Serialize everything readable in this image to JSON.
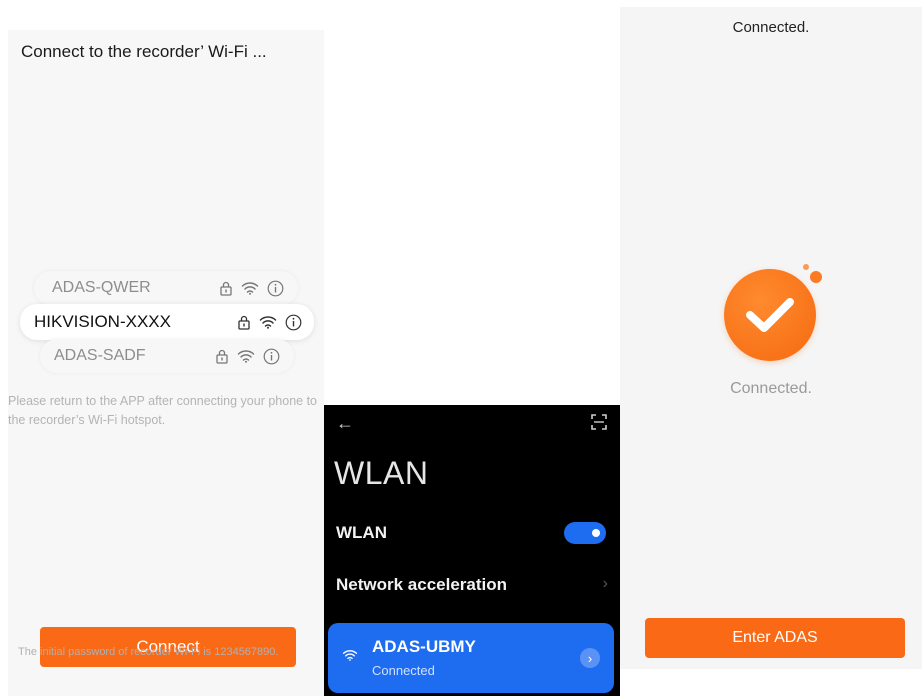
{
  "left_screen": {
    "title": "Connect to the recorder’ Wi-Fi ...",
    "networks": [
      {
        "ssid": "ADAS-QWER",
        "locked": true,
        "selected": false
      },
      {
        "ssid": "HIKVISION-XXXX",
        "locked": true,
        "selected": true
      },
      {
        "ssid": "ADAS-SADF",
        "locked": true,
        "selected": false
      }
    ],
    "hint": "Please return to the APP after connecting your phone to the recorder’s Wi-Fi hotspot.",
    "connect_button": "Connect",
    "footnote": "The initial password of recorder Wi-Fi is 1234567890."
  },
  "phone_settings": {
    "back_icon": "back-arrow-icon",
    "scan_icon": "scan-icon",
    "title": "WLAN",
    "wlan_label": "WLAN",
    "wlan_enabled": true,
    "network_acceleration_label": "Network acceleration",
    "connected_network": {
      "ssid": "ADAS-UBMY",
      "status": "Connected"
    }
  },
  "right_screen": {
    "header": "Connected.",
    "status": "Connected.",
    "enter_button": "Enter ADAS"
  },
  "colors": {
    "accent_orange": "#fa6a16",
    "android_blue": "#1e6cf0"
  }
}
